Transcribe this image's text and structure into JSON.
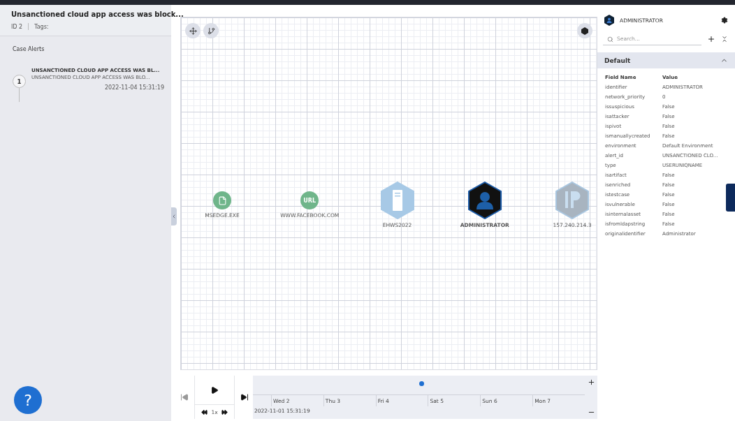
{
  "case": {
    "title": "Unsanctioned cloud app access was block...",
    "id": "ID 2",
    "tags_label": "Tags:"
  },
  "alerts_heading": "Case Alerts",
  "alerts": [
    {
      "number": "1",
      "title": "UNSANCTIONED CLOUD APP ACCESS WAS BL...",
      "subtitle": "UNSANCTIONED CLOUD APP ACCESS WAS BLO...",
      "time": "2022-11-04 15:31:19"
    }
  ],
  "help_button": "?",
  "graph": {
    "nodes": [
      {
        "kind": "file",
        "label": "MSEDGE.EXE",
        "selected": false
      },
      {
        "kind": "url",
        "label": "WWW.FACEBOOK.COM",
        "selected": false,
        "badge": "URL"
      },
      {
        "kind": "host",
        "label": "EHWS2022",
        "selected": false
      },
      {
        "kind": "user",
        "label": "ADMINISTRATOR",
        "selected": true
      },
      {
        "kind": "ip",
        "label": "157.240.214.3",
        "selected": false
      }
    ]
  },
  "timeline": {
    "speed": "1x",
    "days": [
      "Wed 2",
      "Thu 3",
      "Fri 4",
      "Sat 5",
      "Sun 6",
      "Mon 7"
    ],
    "start": "2022-11-01 15:31:19"
  },
  "entity": {
    "name": "ADMINISTRATOR",
    "search_placeholder": "Search...",
    "section": {
      "title": "Default",
      "expanded": true
    },
    "columns": [
      "Field Name",
      "Value"
    ],
    "rows": [
      [
        "identifier",
        "ADMINISTRATOR"
      ],
      [
        "network_priority",
        "0"
      ],
      [
        "issuspicious",
        "False"
      ],
      [
        "isattacker",
        "False"
      ],
      [
        "ispivot",
        "False"
      ],
      [
        "ismanuallycreated",
        "False"
      ],
      [
        "environment",
        "Default Environment"
      ],
      [
        "alert_id",
        "UNSANCTIONED CLO..."
      ],
      [
        "type",
        "USERUNIQNAME"
      ],
      [
        "isartifact",
        "False"
      ],
      [
        "isenriched",
        "False"
      ],
      [
        "istestcase",
        "False"
      ],
      [
        "isvulnerable",
        "False"
      ],
      [
        "isinternalasset",
        "False"
      ],
      [
        "isfromldapstring",
        "False"
      ],
      [
        "originalidentifier",
        "Administrator"
      ]
    ]
  }
}
